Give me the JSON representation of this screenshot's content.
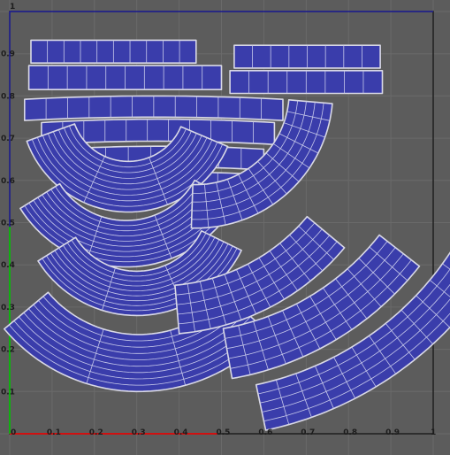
{
  "editor": {
    "background": "#5c5c5c",
    "grid_color": "#6a6a6a",
    "border_color": "#1e1e1e",
    "shell_fill": "#3a3dab",
    "shell_edge": "#d9d9e6",
    "shell_grid": "#c6c8ea",
    "u_axis_color": "#d01010",
    "v_axis_color": "#10b010",
    "frame_blue": "#1414c8"
  },
  "axis": {
    "corner_label": "1",
    "u_labels": [
      "0",
      "0.1",
      "0.2",
      "0.3",
      "0.4",
      "0.5",
      "0.6",
      "0.7",
      "0.8",
      "0.9",
      "1"
    ],
    "v_labels": [
      "0.1",
      "0.2",
      "0.3",
      "0.4",
      "0.5",
      "0.6",
      "0.7",
      "0.8",
      "0.9"
    ]
  },
  "uv_shells": [
    {
      "id": "strip-1",
      "type": "strip",
      "u0": 0.05,
      "u1": 0.44,
      "v0": 0.878,
      "v1": 0.932,
      "cols": 10
    },
    {
      "id": "strip-2",
      "type": "strip",
      "u0": 0.045,
      "u1": 0.5,
      "v0": 0.815,
      "v1": 0.872,
      "cols": 10
    },
    {
      "id": "strip-3",
      "type": "strip",
      "u0": 0.53,
      "u1": 0.875,
      "v0": 0.866,
      "v1": 0.92,
      "cols": 8
    },
    {
      "id": "strip-4",
      "type": "strip",
      "u0": 0.52,
      "u1": 0.88,
      "v0": 0.806,
      "v1": 0.86,
      "cols": 8
    },
    {
      "id": "bent-strip-1",
      "type": "bent-strip",
      "u0": 0.035,
      "u1": 0.645,
      "v0": 0.742,
      "v1": 0.792,
      "bend": 0.008,
      "cols": 12
    },
    {
      "id": "bent-strip-2",
      "type": "bent-strip",
      "u0": 0.075,
      "u1": 0.625,
      "v0": 0.685,
      "v1": 0.737,
      "bend": 0.008,
      "cols": 11
    },
    {
      "id": "bent-strip-3",
      "type": "bent-strip",
      "u0": 0.12,
      "u1": 0.6,
      "v0": 0.625,
      "v1": 0.674,
      "bend": 0.007,
      "cols": 9
    },
    {
      "id": "bent-strip-4",
      "type": "bent-strip",
      "u0": 0.11,
      "u1": 0.6,
      "v0": 0.565,
      "v1": 0.614,
      "bend": 0.006,
      "cols": 9
    },
    {
      "id": "arc-left-1",
      "type": "arc",
      "cu": 0.28,
      "cv": 0.78,
      "r0": 0.135,
      "r1": 0.255,
      "a0": 200,
      "a1": 337,
      "cols": 9,
      "rows": 3
    },
    {
      "id": "arc-left-2",
      "type": "arc",
      "cu": 0.275,
      "cv": 0.69,
      "r0": 0.185,
      "r1": 0.295,
      "a0": 212,
      "a1": 331,
      "cols": 9,
      "rows": 3
    },
    {
      "id": "arc-left-3",
      "type": "arc",
      "cu": 0.3,
      "cv": 0.555,
      "r0": 0.17,
      "r1": 0.275,
      "a0": 212,
      "a1": 334,
      "cols": 9,
      "rows": 3
    },
    {
      "id": "arc-left-4",
      "type": "arc",
      "cu": 0.305,
      "cv": 0.515,
      "r0": 0.28,
      "r1": 0.415,
      "a0": 220,
      "a1": 318,
      "cols": 9,
      "rows": 3
    },
    {
      "id": "arc-right-1",
      "type": "arc",
      "cu": 0.44,
      "cv": 0.81,
      "r0": 0.22,
      "r1": 0.323,
      "a0": 268,
      "a1": 355,
      "cols": 5,
      "rows": 12
    },
    {
      "id": "arc-right-2",
      "type": "arc",
      "cu": 0.35,
      "cv": 0.81,
      "r0": 0.46,
      "r1": 0.575,
      "a0": 275,
      "a1": 320,
      "cols": 5,
      "rows": 12
    },
    {
      "id": "arc-right-3",
      "type": "arc",
      "cu": 0.4,
      "cv": 0.84,
      "r0": 0.6,
      "r1": 0.72,
      "a0": 280,
      "a1": 322,
      "cols": 5,
      "rows": 12
    },
    {
      "id": "arc-right-4",
      "type": "arc",
      "cu": 0.43,
      "cv": 0.83,
      "r0": 0.73,
      "r1": 0.84,
      "a0": 282,
      "a1": 328,
      "cols": 5,
      "rows": 12
    }
  ]
}
